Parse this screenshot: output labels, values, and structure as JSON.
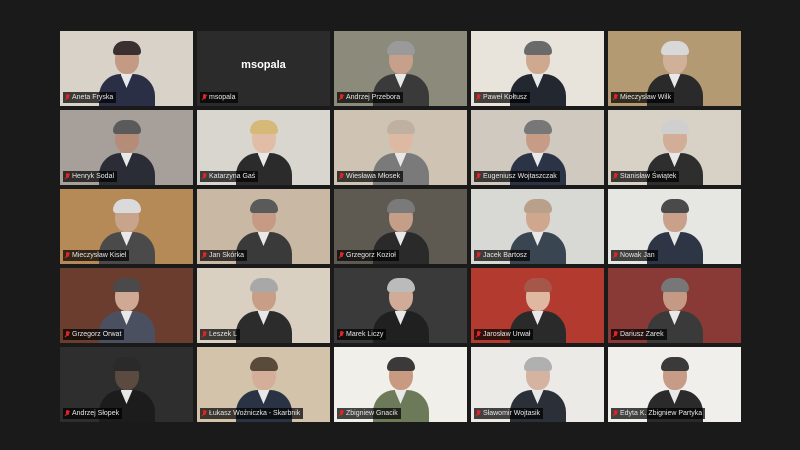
{
  "participants": [
    {
      "name": "Aneta Fryska",
      "bg": "#d9d2c8",
      "skin": "#c49a84",
      "shirt": "#2a2f45",
      "hair": "#3a3030",
      "video": true
    },
    {
      "name": "msopala",
      "bg": "#2b2b2b",
      "video": false,
      "display": "msopala"
    },
    {
      "name": "Andrzej Przebora",
      "bg": "#8c8a7a",
      "skin": "#c6a08a",
      "shirt": "#3a3a3a",
      "hair": "#9a9a9a",
      "video": true
    },
    {
      "name": "Paweł Kołtusz",
      "bg": "#e8e4dc",
      "skin": "#cfa98f",
      "shirt": "#23272f",
      "hair": "#6a6a6a",
      "video": true
    },
    {
      "name": "Mieczysław Wilk",
      "bg": "#b49a73",
      "skin": "#d1b09a",
      "shirt": "#2a2a2a",
      "hair": "#d8d8d8",
      "video": true
    },
    {
      "name": "Henryk Sodal",
      "bg": "#a7a09a",
      "skin": "#b58c78",
      "shirt": "#2a2d36",
      "hair": "#5a5a5a",
      "video": true
    },
    {
      "name": "Katarzyna Gaś",
      "bg": "#d8d6cf",
      "skin": "#e1bca6",
      "shirt": "#2b2b2b",
      "hair": "#d6b878",
      "video": true
    },
    {
      "name": "Wiesława Młosek",
      "bg": "#cfc4b4",
      "skin": "#ddb8a2",
      "shirt": "#7a7a7a",
      "hair": "#c0b0a0",
      "video": true,
      "active": true
    },
    {
      "name": "Eugeniusz Wojtaszczak",
      "bg": "#cfc9bf",
      "skin": "#c79c86",
      "shirt": "#2b3346",
      "hair": "#777",
      "video": true
    },
    {
      "name": "Stanisław Świątek",
      "bg": "#d8d1c6",
      "skin": "#d2ad98",
      "shirt": "#2e2e2e",
      "hair": "#cfcfcf",
      "video": true
    },
    {
      "name": "Mieczysław Kisiel",
      "bg": "#b58a57",
      "skin": "#c9a48d",
      "shirt": "#4a4a4a",
      "hair": "#dadada",
      "video": true
    },
    {
      "name": "Jan Skórka",
      "bg": "#c9b8a4",
      "skin": "#c69a84",
      "shirt": "#3a3a3a",
      "hair": "#5a5a5a",
      "video": true
    },
    {
      "name": "Grzegorz Kozioł",
      "bg": "#5e5a52",
      "skin": "#c59e88",
      "shirt": "#2a2a2a",
      "hair": "#7a7a7a",
      "video": true
    },
    {
      "name": "Jacek Bartosz",
      "bg": "#d8d8d4",
      "skin": "#cfa68e",
      "shirt": "#3a4552",
      "hair": "#b8a08a",
      "video": true
    },
    {
      "name": "Nowak Jan",
      "bg": "#e6e6e3",
      "skin": "#c9a08a",
      "shirt": "#2e3544",
      "hair": "#4a4a4a",
      "video": true
    },
    {
      "name": "Grzegorz Orwat",
      "bg": "#6a3d2e",
      "skin": "#d0a994",
      "shirt": "#4a5060",
      "hair": "#4a4a4a",
      "video": true
    },
    {
      "name": "Leszek L",
      "bg": "#d9d0c2",
      "skin": "#c99e87",
      "shirt": "#2c2c2c",
      "hair": "#a8a8a8",
      "video": true
    },
    {
      "name": "Marek Liczy",
      "bg": "#3a3a3a",
      "skin": "#d0ab97",
      "shirt": "#202020",
      "hair": "#bbbbbb",
      "video": true
    },
    {
      "name": "Jarosław Urwał",
      "bg": "#b33a2e",
      "skin": "#e0b8a2",
      "shirt": "#2a2a2a",
      "hair": "#a5574a",
      "video": true
    },
    {
      "name": "Dariusz Zarek",
      "bg": "#8a3a36",
      "skin": "#c59a84",
      "shirt": "#3a3a3a",
      "hair": "#777",
      "video": true
    },
    {
      "name": "Andrzej Słopek",
      "bg": "#2e2e2e",
      "skin": "#5a4a40",
      "shirt": "#1c1c1c",
      "hair": "#2a2a2a",
      "video": true
    },
    {
      "name": "Łukasz Woźniczka - Skarbnik",
      "bg": "#d3c3aa",
      "skin": "#d3ae98",
      "shirt": "#2a3344",
      "hair": "#5a4a3a",
      "video": true
    },
    {
      "name": "Zbigniew Gnacik",
      "bg": "#f0efe9",
      "skin": "#c89a82",
      "shirt": "#6d7a5a",
      "hair": "#3a3a3a",
      "video": true
    },
    {
      "name": "Sławomir Wojtasik",
      "bg": "#ebeae6",
      "skin": "#d4b3a0",
      "shirt": "#2b2f38",
      "hair": "#b0b0b0",
      "video": true
    },
    {
      "name": "Edyta K. Zbigniew Partyka",
      "bg": "#f1efeb",
      "skin": "#c79c86",
      "shirt": "#2a2a2a",
      "hair": "#3a3a3a",
      "video": true
    }
  ]
}
